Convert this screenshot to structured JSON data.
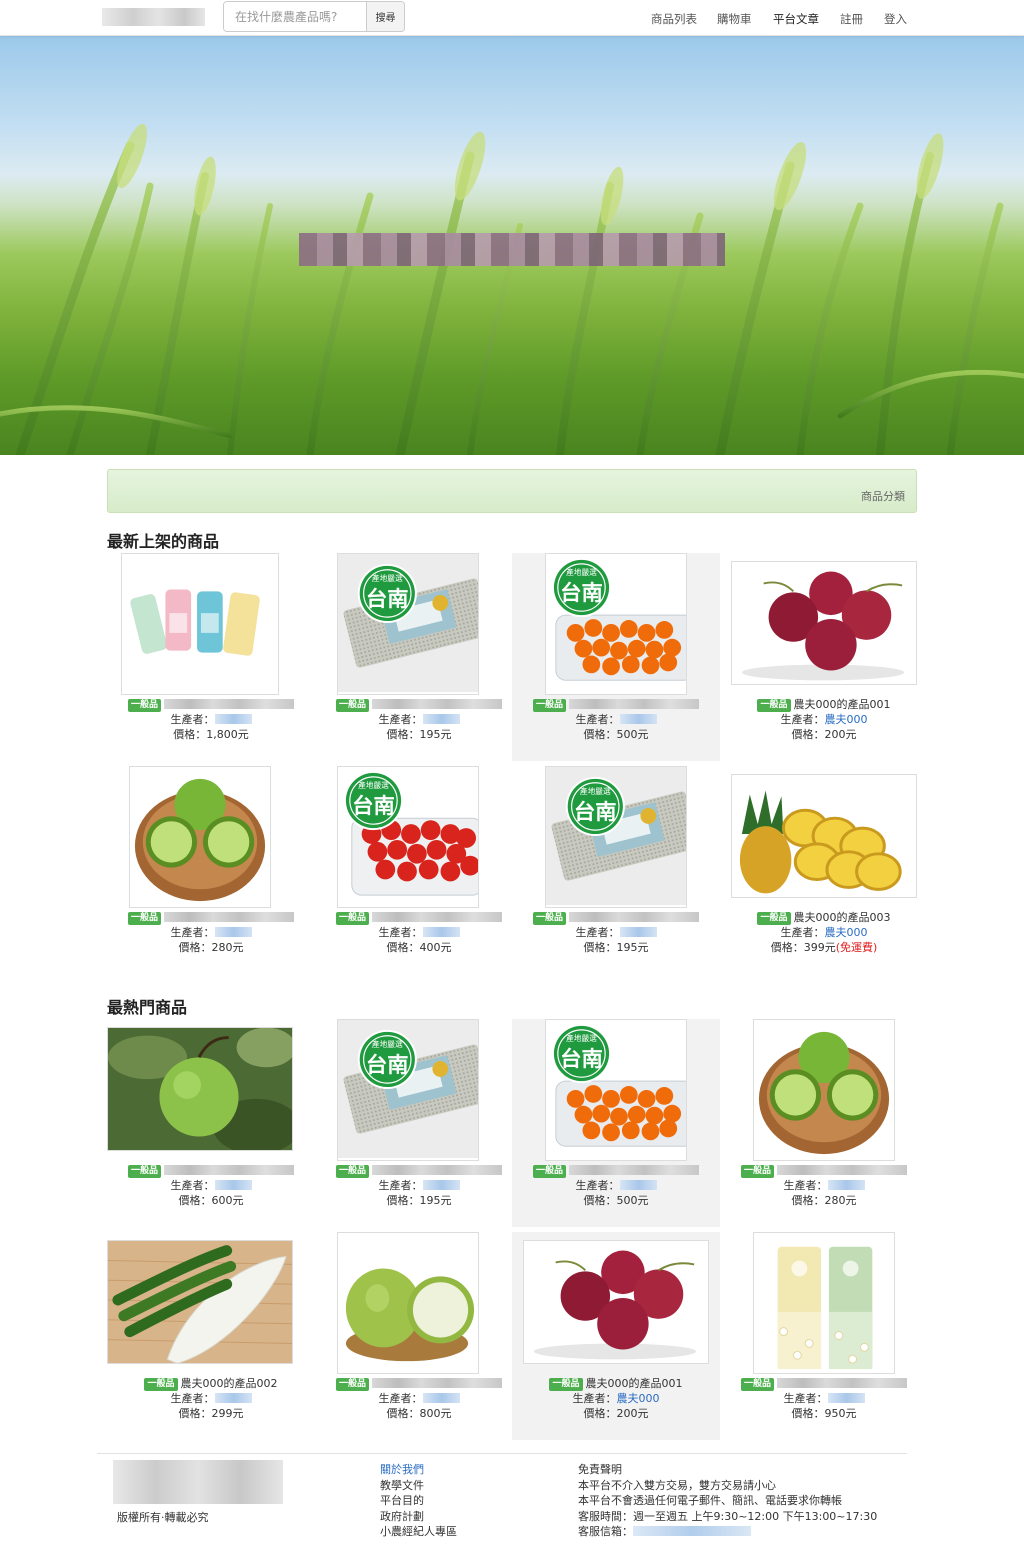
{
  "header": {
    "search_placeholder": "在找什麼農產品嗎?",
    "search_button": "搜尋",
    "nav": [
      "商品列表",
      "購物車",
      "平台文章",
      "註冊",
      "登入"
    ]
  },
  "catbar": {
    "label": "商品分類"
  },
  "sections": {
    "newest": "最新上架的商品",
    "popular": "最熱門商品"
  },
  "labels": {
    "badge": "一般品",
    "producer": "生產者：",
    "price": "價格："
  },
  "newest_products": [
    {
      "name": "",
      "producer": "",
      "price": "1,800元",
      "icon": "tea-cans-image"
    },
    {
      "name": "",
      "producer": "",
      "price": "195元",
      "icon": "rice-pack-image"
    },
    {
      "name": "",
      "producer": "",
      "price": "500元",
      "icon": "orange-tomato-image"
    },
    {
      "name": "農夫000的產品001",
      "producer": "農夫000",
      "price": "200元",
      "icon": "passion-fruit-image"
    },
    {
      "name": "",
      "producer": "",
      "price": "280元",
      "icon": "lime-bowl-image"
    },
    {
      "name": "",
      "producer": "",
      "price": "400元",
      "icon": "red-tomato-image"
    },
    {
      "name": "",
      "producer": "",
      "price": "195元",
      "icon": "rice-pack-image"
    },
    {
      "name": "農夫000的產品003",
      "producer": "農夫000",
      "price": "399元",
      "extra": "(免運費)",
      "icon": "pineapple-image"
    }
  ],
  "popular_products": [
    {
      "name": "",
      "producer": "",
      "price": "600元",
      "icon": "pomelo-tree-image"
    },
    {
      "name": "",
      "producer": "",
      "price": "195元",
      "icon": "rice-pack-image"
    },
    {
      "name": "",
      "producer": "",
      "price": "500元",
      "icon": "orange-tomato-image"
    },
    {
      "name": "",
      "producer": "",
      "price": "280元",
      "icon": "lime-bowl-image"
    },
    {
      "name": "農夫000的產品002",
      "producer": "",
      "price": "299元",
      "icon": "cucumber-bittermelon-image"
    },
    {
      "name": "",
      "producer": "",
      "price": "800元",
      "icon": "guava-image"
    },
    {
      "name": "農夫000的產品001",
      "producer": "農夫000",
      "price": "200元",
      "icon": "passion-fruit-image"
    },
    {
      "name": "",
      "producer": "",
      "price": "950元",
      "icon": "tea-tubes-image"
    }
  ],
  "stamp_text": "台南",
  "stamp_sub": "產地嚴選",
  "footer": {
    "copyright": "版權所有‧轉載必究",
    "links": [
      "關於我們",
      "教學文件",
      "平台目的",
      "政府計劃",
      "小農經紀人專區"
    ],
    "info": [
      "免責聲明",
      "本平台不介入雙方交易，雙方交易請小心",
      "本平台不會透過任何電子郵件、簡訊、電話要求你轉帳",
      "客服時間：週一至週五 上午9:30~12:00 下午13:00~17:30",
      "客服信箱："
    ]
  },
  "colors": {
    "badge": "#4cae4c",
    "link": "#2a6cc4",
    "free_shipping": "#e02020",
    "catbar": "#dff0d8"
  }
}
